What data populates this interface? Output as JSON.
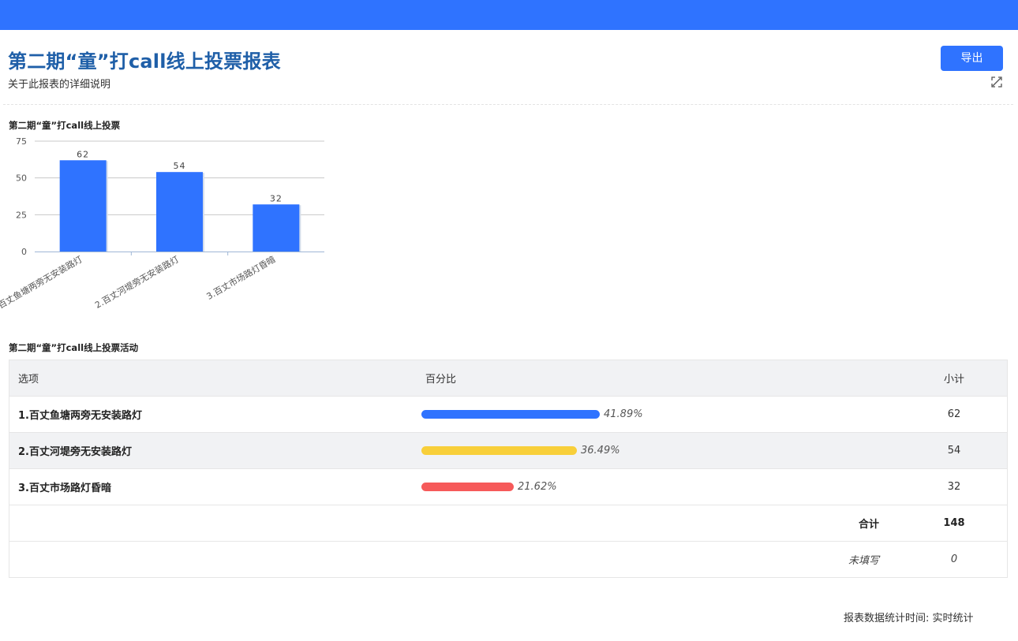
{
  "header": {
    "title": "第二期“童”打call线上投票报表",
    "subtitle": "关于此报表的详细说明",
    "export_label": "导出",
    "accent_color": "#2f73ff"
  },
  "chart_data": {
    "type": "bar",
    "title": "第二期“童”打call线上投票",
    "categories": [
      "1.百丈鱼塘两旁无安装路灯",
      "2.百丈河堤旁无安装路灯",
      "3.百丈市场路灯昏暗"
    ],
    "values": [
      62,
      54,
      32
    ],
    "ylim": [
      0,
      75
    ],
    "yticks": [
      0,
      25,
      50,
      75
    ],
    "grid": true,
    "bar_color": "#2f73ff"
  },
  "table": {
    "title": "第二期“童”打call线上投票活动",
    "headers": [
      "选项",
      "百分比",
      "小计"
    ],
    "rows": [
      {
        "option": "1.百丈鱼塘两旁无安装路灯",
        "percent": "41.89%",
        "fraction": 0.4189,
        "count": "62",
        "color": "#2f73ff"
      },
      {
        "option": "2.百丈河堤旁无安装路灯",
        "percent": "36.49%",
        "fraction": 0.3649,
        "count": "54",
        "color": "#f8cf3a"
      },
      {
        "option": "3.百丈市场路灯昏暗",
        "percent": "21.62%",
        "fraction": 0.2162,
        "count": "32",
        "color": "#f65a5a"
      }
    ],
    "total_label": "合计",
    "total_value": "148",
    "blank_label": "未填写",
    "blank_value": "0"
  },
  "footer": {
    "text": "报表数据统计时间: 实时统计"
  }
}
